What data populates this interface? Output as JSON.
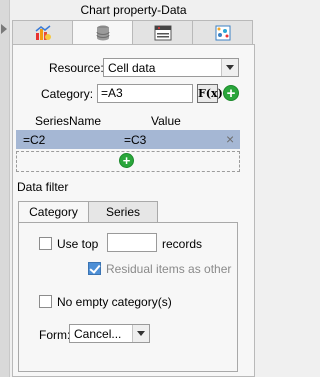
{
  "panel": {
    "title": "Chart property-Data"
  },
  "tabs": [
    {
      "icon": "chart-icon"
    },
    {
      "icon": "database-icon"
    },
    {
      "icon": "chart-edit-icon"
    },
    {
      "icon": "scatter-settings-icon"
    }
  ],
  "resource": {
    "label": "Resource:",
    "value": "Cell data"
  },
  "category": {
    "label": "Category:",
    "value": "=A3",
    "fx_label": "F(x)"
  },
  "series_table": {
    "headers": [
      "SeriesName",
      "Value"
    ],
    "rows": [
      {
        "name": "=C2",
        "value": "=C3"
      }
    ],
    "remove_glyph": "×"
  },
  "add_glyph": "+",
  "data_filter": {
    "heading": "Data filter",
    "tabs": [
      "Category",
      "Series"
    ],
    "use_top": {
      "label": "Use top",
      "value": "",
      "suffix": "records",
      "checked": false
    },
    "residual": {
      "label": "Residual items as other",
      "checked": true
    },
    "no_empty": {
      "label": "No empty category(s)",
      "checked": false
    },
    "form": {
      "label": "Form:",
      "value": "Cancel..."
    }
  }
}
